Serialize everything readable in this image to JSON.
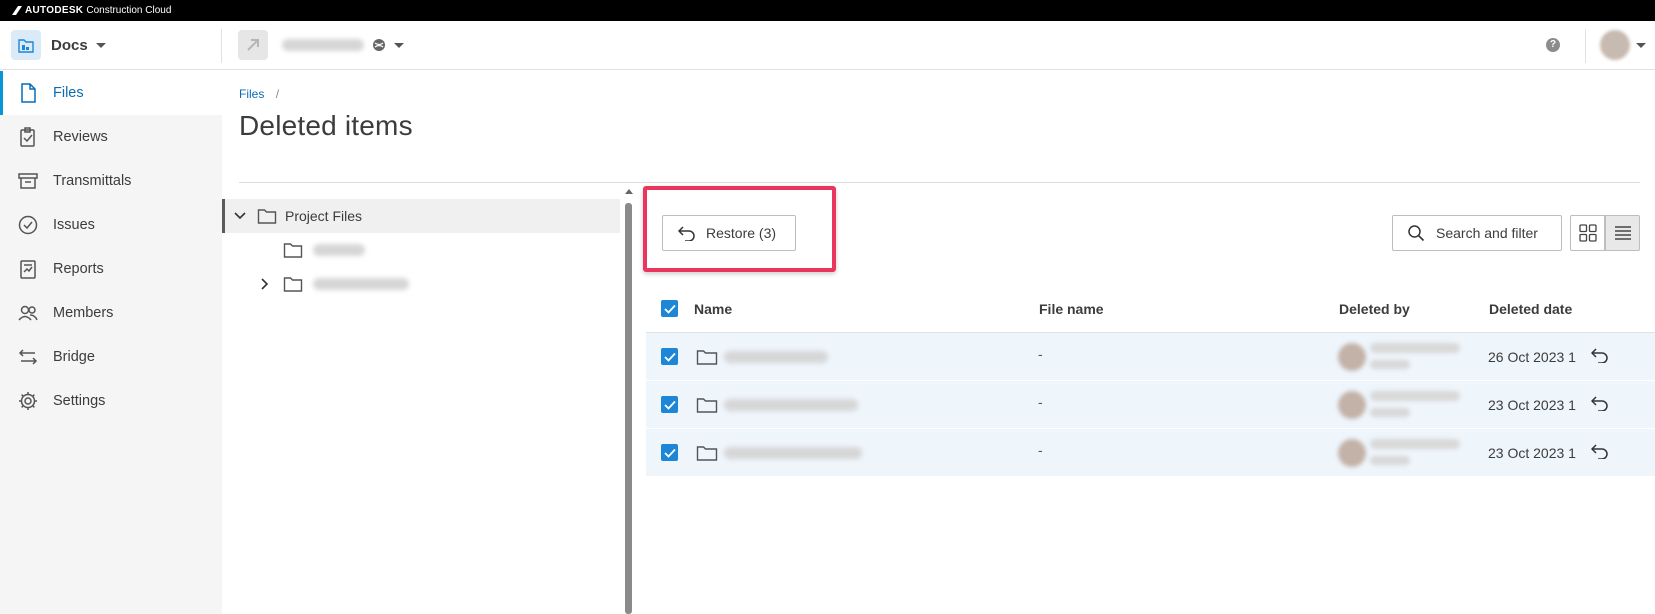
{
  "brand": {
    "name_strong": "AUTODESK",
    "name_rest": "Construction Cloud"
  },
  "header": {
    "module": "Docs",
    "help": "?"
  },
  "sidebar": {
    "items": [
      {
        "label": "Files",
        "icon": "file-icon",
        "active": true
      },
      {
        "label": "Reviews",
        "icon": "reviews-icon"
      },
      {
        "label": "Transmittals",
        "icon": "transmittals-icon"
      },
      {
        "label": "Issues",
        "icon": "issues-icon"
      },
      {
        "label": "Reports",
        "icon": "reports-icon"
      },
      {
        "label": "Members",
        "icon": "members-icon"
      },
      {
        "label": "Bridge",
        "icon": "bridge-icon"
      },
      {
        "label": "Settings",
        "icon": "gear-icon"
      }
    ]
  },
  "breadcrumb": {
    "link": "Files",
    "separator": "/"
  },
  "page": {
    "title": "Deleted items"
  },
  "tree": {
    "root": "Project Files"
  },
  "toolbar": {
    "restore": "Restore (3)",
    "search": "Search and filter"
  },
  "table": {
    "headers": {
      "name": "Name",
      "file_name": "File name",
      "deleted_by": "Deleted by",
      "deleted_date": "Deleted date"
    },
    "rows": [
      {
        "file_name": "-",
        "deleted_date": "26 Oct 2023 1",
        "checked": true
      },
      {
        "file_name": "-",
        "deleted_date": "23 Oct 2023 1",
        "checked": true
      },
      {
        "file_name": "-",
        "deleted_date": "23 Oct 2023 1",
        "checked": true
      }
    ]
  },
  "colors": {
    "accent": "#0696d7",
    "highlight": "#e8365f",
    "checkbox": "#1d86d6",
    "row_selected": "#eef5fb"
  }
}
